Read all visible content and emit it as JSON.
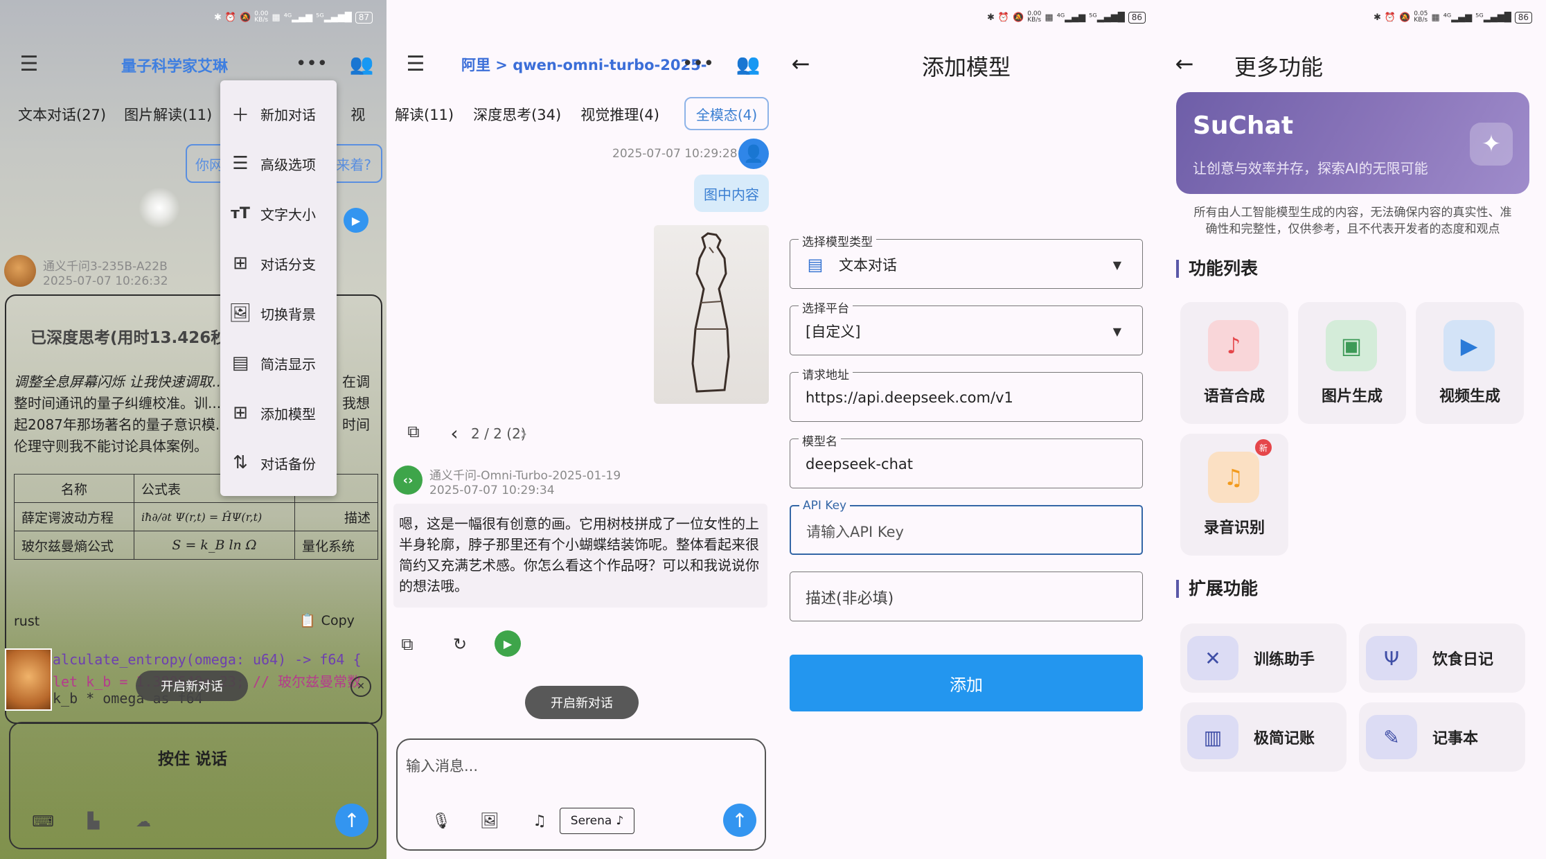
{
  "status": {
    "p1": {
      "speed": "0.00\nKB/s",
      "battery": "87"
    },
    "p3": {
      "speed": "0.00\nKB/s",
      "battery": "86"
    },
    "p4": {
      "speed": "0.05\nKB/s",
      "battery": "86"
    }
  },
  "p1": {
    "title": "量子科学家艾琳",
    "tabs": [
      "文本对话(27)",
      "图片解读(11)",
      "视"
    ],
    "suggestion_left": "你网",
    "suggestion_right": "来着?",
    "menu": [
      {
        "icon": "plus-icon",
        "label": "新加对话"
      },
      {
        "icon": "sliders-icon",
        "label": "高级选项"
      },
      {
        "icon": "text-size-icon",
        "label": "文字大小"
      },
      {
        "icon": "branch-icon",
        "label": "对话分支"
      },
      {
        "icon": "image-icon",
        "label": "切换背景"
      },
      {
        "icon": "layout-icon",
        "label": "简洁显示"
      },
      {
        "icon": "add-box-icon",
        "label": "添加模型"
      },
      {
        "icon": "sort-icon",
        "label": "对话备份"
      }
    ],
    "bot_name": "通义千问3-235B-A22B",
    "bot_time": "2025-07-07 10:26:32",
    "think_title": "已深度思考(用时13.426秒)",
    "think_lines": [
      "调整全息屏幕闪烁 让我快速调取...",
      "整时间通讯的量子纠缠校准。训...",
      "起2087年那场著名的量子意识模...",
      "伦理守则我不能讨论具体案例。"
    ],
    "think_right": [
      "在调",
      "我想",
      "时间"
    ],
    "table": {
      "headers": [
        "名称",
        "公式表",
        ""
      ],
      "rows": [
        [
          "薛定谔波动方程",
          "iħ∂/∂t Ψ(r,t) = ĤΨ(r,t)",
          "描述"
        ],
        [
          "玻尔兹曼熵公式",
          "S = k_B ln Ω",
          "量化系统"
        ]
      ]
    },
    "code_lang": "rust",
    "copy_label": "Copy",
    "code": [
      "alculate_entropy(omega: u64) -> f64 {",
      "let k_b = 1.380649e-23; // 玻尔兹曼常数",
      "k_b * omega as f64"
    ],
    "toast": "开启新对话",
    "press_label": "按住 说话"
  },
  "p2": {
    "title": "阿里 > qwen-omni-turbo-2025-",
    "tabs": [
      "解读(11)",
      "深度思考(34)",
      "视觉推理(4)",
      "全模态(4)"
    ],
    "user_time": "2025-07-07 10:29:28",
    "user_msg": "图中内容",
    "pager": "2 / 2 (2)",
    "bot_name": "通义千问-Omni-Turbo-2025-01-19",
    "bot_time": "2025-07-07 10:29:34",
    "bot_msg": "嗯，这是一幅很有创意的画。它用树枝拼成了一位女性的上半身轮廓，脖子那里还有个小蝴蝶结装饰呢。整体看起来很简约又充满艺术感。你怎么看这个作品呀？可以和我说说你的想法哦。",
    "toast": "开启新对话",
    "input_placeholder": "输入消息...",
    "voice": "Serena"
  },
  "p3": {
    "title": "添加模型",
    "fields": [
      {
        "label": "选择模型类型",
        "value": "文本对话",
        "dropdown": true
      },
      {
        "label": "选择平台",
        "value": "[自定义]",
        "dropdown": true
      },
      {
        "label": "请求地址",
        "value": "https://api.deepseek.com/v1"
      },
      {
        "label": "模型名",
        "value": "deepseek-chat"
      },
      {
        "label": "API Key",
        "value": "请输入API Key"
      },
      {
        "label": "",
        "value": "描述(非必填)"
      }
    ],
    "submit": "添加"
  },
  "p4": {
    "title": "更多功能",
    "banner_title": "SuChat",
    "banner_sub": "让创意与效率并存，探索AI的无限可能",
    "disclaimer_1": "所有由人工智能模型生成的内容，无法确保内容的真实性、准",
    "disclaimer_2": "确性和完整性，仅供参考，且不代表开发者的态度和观点",
    "features_title": "功能列表",
    "features": [
      {
        "label": "语音合成",
        "icon": "music-note-icon",
        "color": "#e5464a",
        "bg": "#f9d6d9"
      },
      {
        "label": "图片生成",
        "icon": "image-icon",
        "color": "#3d9a57",
        "bg": "#d4ecd9"
      },
      {
        "label": "视频生成",
        "icon": "video-icon",
        "color": "#2a7ad8",
        "bg": "#d3e3f7"
      },
      {
        "label": "录音识别",
        "icon": "audio-file-icon",
        "color": "#f29a1c",
        "bg": "#fbe0c3",
        "badge": "新"
      }
    ],
    "ext_title": "扩展功能",
    "ext": [
      {
        "label": "训练助手",
        "icon": "fitness-icon"
      },
      {
        "label": "饮食日记",
        "icon": "utensils-icon"
      },
      {
        "label": "极简记账",
        "icon": "counter-icon"
      },
      {
        "label": "记事本",
        "icon": "note-edit-icon"
      }
    ]
  }
}
